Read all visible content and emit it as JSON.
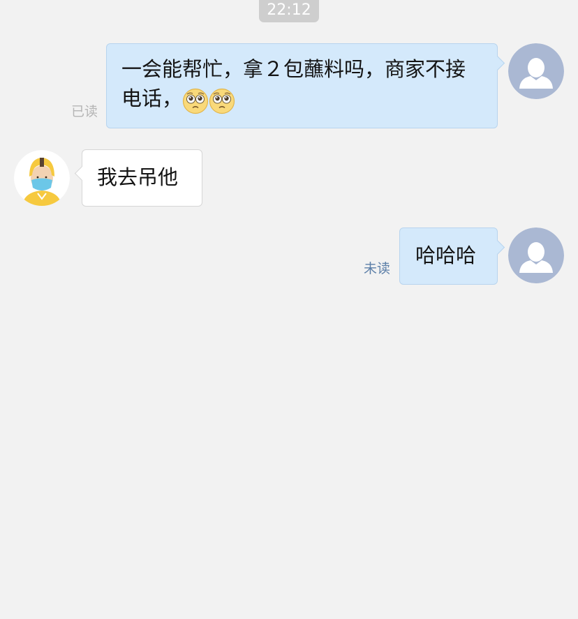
{
  "timestamp": "22:12",
  "messages": [
    {
      "sender": "self",
      "text": "一会能帮忙，拿２包蘸料吗，商家不接电话，",
      "emojis": [
        "pleading-face",
        "pleading-face"
      ],
      "status": "已读"
    },
    {
      "sender": "courier",
      "text": "我去吊他"
    },
    {
      "sender": "self",
      "text": "哈哈哈",
      "status": "未读"
    }
  ],
  "colors": {
    "background": "#f2f2f2",
    "outgoing_bubble": "#d4e9fb",
    "incoming_bubble": "#ffffff",
    "timestamp_badge": "#cecece",
    "read_status": "#b5b5b5",
    "unread_status": "#5c7fa8",
    "default_avatar": "#aab8d3"
  }
}
